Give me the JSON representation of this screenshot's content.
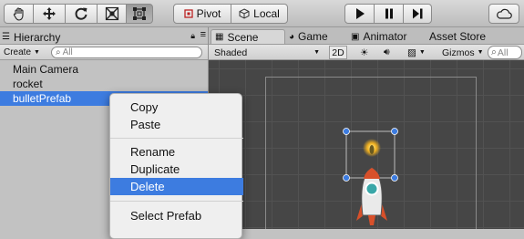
{
  "toolbar": {
    "tools": [
      {
        "name": "hand-tool-icon"
      },
      {
        "name": "move-tool-icon"
      },
      {
        "name": "rotate-tool-icon"
      },
      {
        "name": "scale-tool-icon"
      },
      {
        "name": "rect-tool-icon",
        "active": true
      }
    ],
    "pivot_label": "Pivot",
    "local_label": "Local",
    "play": {
      "play": "play-icon",
      "pause": "pause-icon",
      "step": "step-icon"
    },
    "cloud": "cloud-icon"
  },
  "hierarchy": {
    "tab_label": "Hierarchy",
    "create_label": "Create",
    "search_placeholder": "All",
    "items": [
      {
        "label": "Main Camera"
      },
      {
        "label": "rocket"
      },
      {
        "label": "bulletPrefab",
        "selected": true
      }
    ]
  },
  "scene": {
    "tabs": {
      "scene": "Scene",
      "game": "Game",
      "animator": "Animator",
      "asset_store": "Asset Store"
    },
    "shading_mode": "Shaded",
    "mode_2d": "2D",
    "gizmos_label": "Gizmos",
    "search_placeholder": "All"
  },
  "context_menu": {
    "items": [
      {
        "label": "Copy"
      },
      {
        "label": "Paste"
      },
      {
        "label": "Rename"
      },
      {
        "label": "Duplicate"
      },
      {
        "label": "Delete",
        "highlighted": true
      },
      {
        "label": "Select Prefab"
      }
    ]
  },
  "colors": {
    "selection": "#3d7ce0",
    "viewport": "#464646",
    "panel": "#c2c2c2"
  }
}
